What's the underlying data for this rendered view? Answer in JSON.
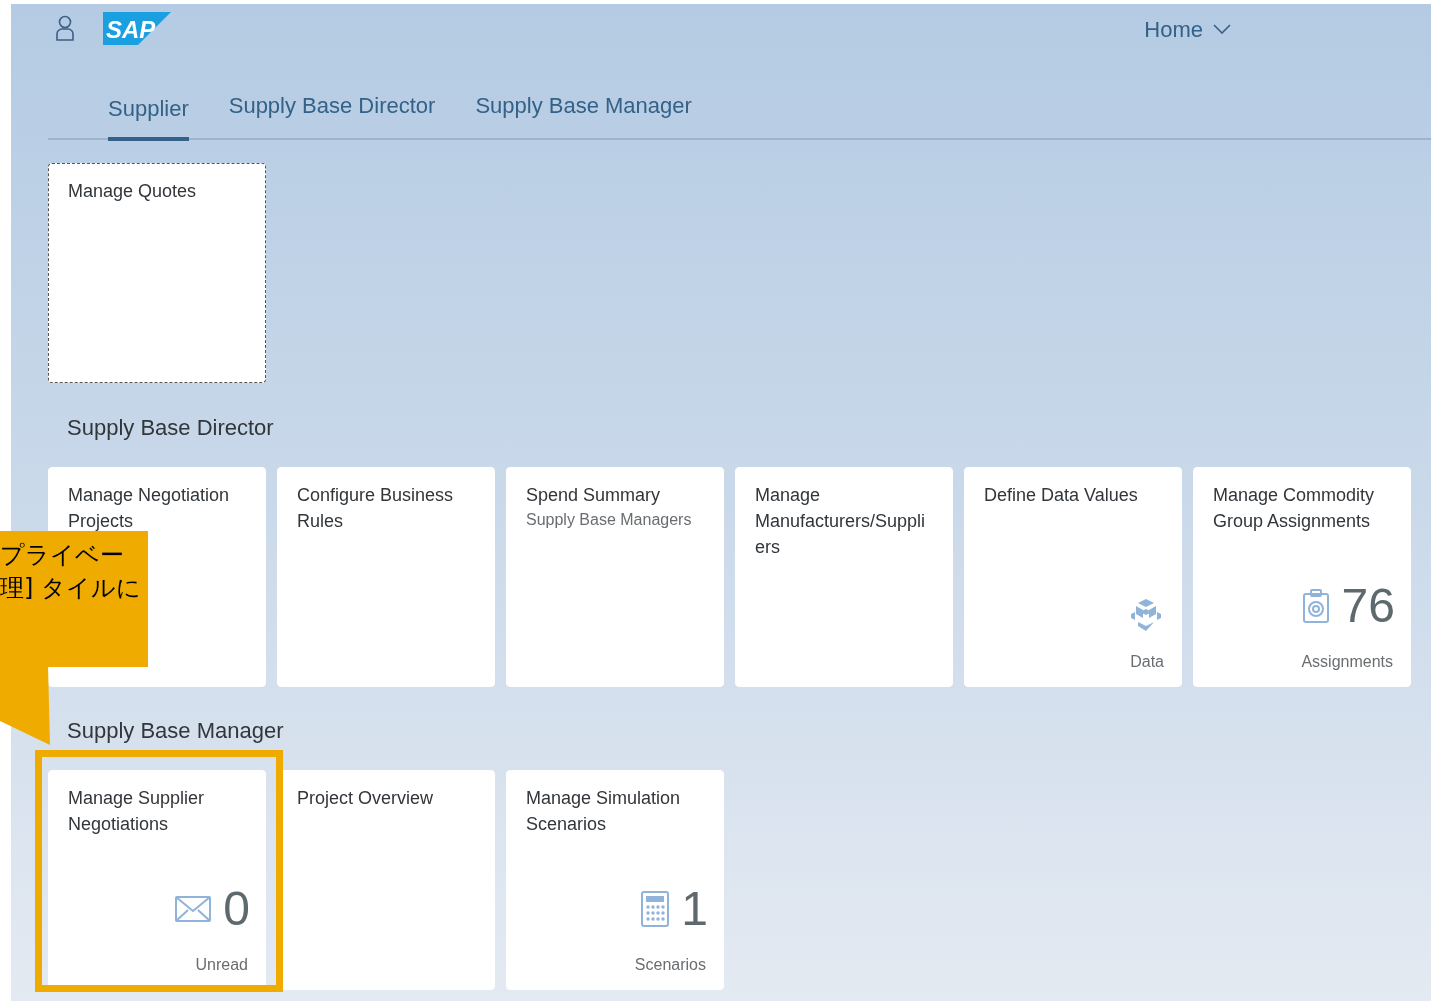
{
  "header": {
    "logo": "SAP",
    "home_menu": "Home"
  },
  "tabs": [
    {
      "label": "Supplier",
      "selected": true
    },
    {
      "label": "Supply Base Director",
      "selected": false
    },
    {
      "label": "Supply Base Manager",
      "selected": false
    }
  ],
  "sections": [
    {
      "tiles": [
        {
          "kind": "plain",
          "title": "Manage Quotes",
          "focused": true
        }
      ]
    },
    {
      "title": "Supply Base Director",
      "tiles": [
        {
          "kind": "plain",
          "title": "Manage Negotiation Projects",
          "focused": false
        },
        {
          "kind": "plain",
          "title": "Configure Business Rules",
          "focused": false
        },
        {
          "kind": "plain",
          "title": "Spend Summary",
          "subtitle": "Supply Base Managers",
          "focused": false
        },
        {
          "kind": "plain",
          "title": "Manage Manufacturers/Suppliers",
          "focused": false
        },
        {
          "kind": "icon",
          "title": "Define Data Values",
          "footer": "Data",
          "focused": false
        },
        {
          "kind": "kpi",
          "title": "Manage Commodity Group Assignments",
          "number": "76",
          "footer": "Assignments",
          "focused": false
        }
      ]
    },
    {
      "title": "Supply Base Manager",
      "tiles": [
        {
          "kind": "kpi",
          "title": "Manage Supplier Negotiations",
          "number": "0",
          "footer": "Unread",
          "focused": false
        },
        {
          "kind": "plain",
          "title": "Project Overview",
          "focused": false
        },
        {
          "kind": "kpi",
          "title": "Manage Simulation Scenarios",
          "number": "1",
          "footer": "Scenarios",
          "focused": false
        }
      ]
    }
  ],
  "callout": {
    "lines": [
      "プライベー",
      "理] タイルに"
    ]
  }
}
